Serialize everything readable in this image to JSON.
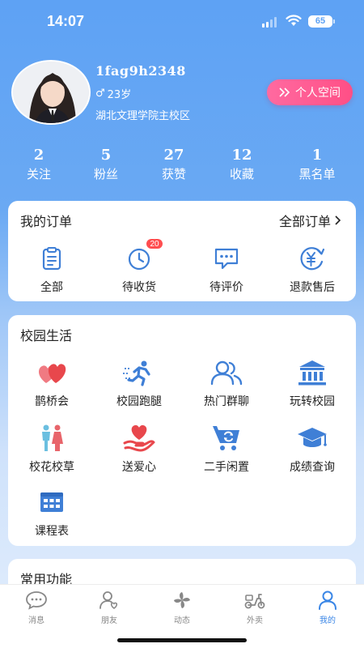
{
  "status": {
    "time": "14:07",
    "battery": "65"
  },
  "profile": {
    "username": "1fag9h2348",
    "gender_symbol": "♂",
    "age": "23岁",
    "school": "湖北文理学院主校区",
    "space_button": "个人空间"
  },
  "stats": [
    {
      "num": "2",
      "label": "关注"
    },
    {
      "num": "5",
      "label": "粉丝"
    },
    {
      "num": "27",
      "label": "获赞"
    },
    {
      "num": "12",
      "label": "收藏"
    },
    {
      "num": "1",
      "label": "黑名单"
    }
  ],
  "orders": {
    "title": "我的订单",
    "all_link": "全部订单",
    "items": [
      {
        "label": "全部",
        "icon": "clipboard-icon"
      },
      {
        "label": "待收货",
        "icon": "clock-icon",
        "badge": "20"
      },
      {
        "label": "待评价",
        "icon": "chat-icon"
      },
      {
        "label": "退款售后",
        "icon": "refund-icon"
      }
    ]
  },
  "campus": {
    "title": "校园生活",
    "items": [
      {
        "label": "鹊桥会",
        "icon": "hearts-icon"
      },
      {
        "label": "校园跑腿",
        "icon": "runner-icon"
      },
      {
        "label": "热门群聊",
        "icon": "group-icon"
      },
      {
        "label": "玩转校园",
        "icon": "building-icon"
      },
      {
        "label": "校花校草",
        "icon": "couple-icon"
      },
      {
        "label": "送爱心",
        "icon": "hand-heart-icon"
      },
      {
        "label": "二手闲置",
        "icon": "cart-icon"
      },
      {
        "label": "成绩查询",
        "icon": "graduation-cap-icon"
      },
      {
        "label": "课程表",
        "icon": "calendar-icon"
      }
    ]
  },
  "common": {
    "title": "常用功能"
  },
  "tabs": [
    {
      "label": "消息",
      "icon": "message-icon"
    },
    {
      "label": "朋友",
      "icon": "friends-icon"
    },
    {
      "label": "动态",
      "icon": "pinwheel-icon"
    },
    {
      "label": "外卖",
      "icon": "scooter-icon"
    },
    {
      "label": "我的",
      "icon": "person-icon",
      "active": true
    }
  ],
  "colors": {
    "accent": "#3a86e6",
    "pink": "#ff4f86",
    "badge": "#ff4d4f",
    "icon_blue": "#3f7fd6",
    "icon_red": "#e8474c"
  }
}
